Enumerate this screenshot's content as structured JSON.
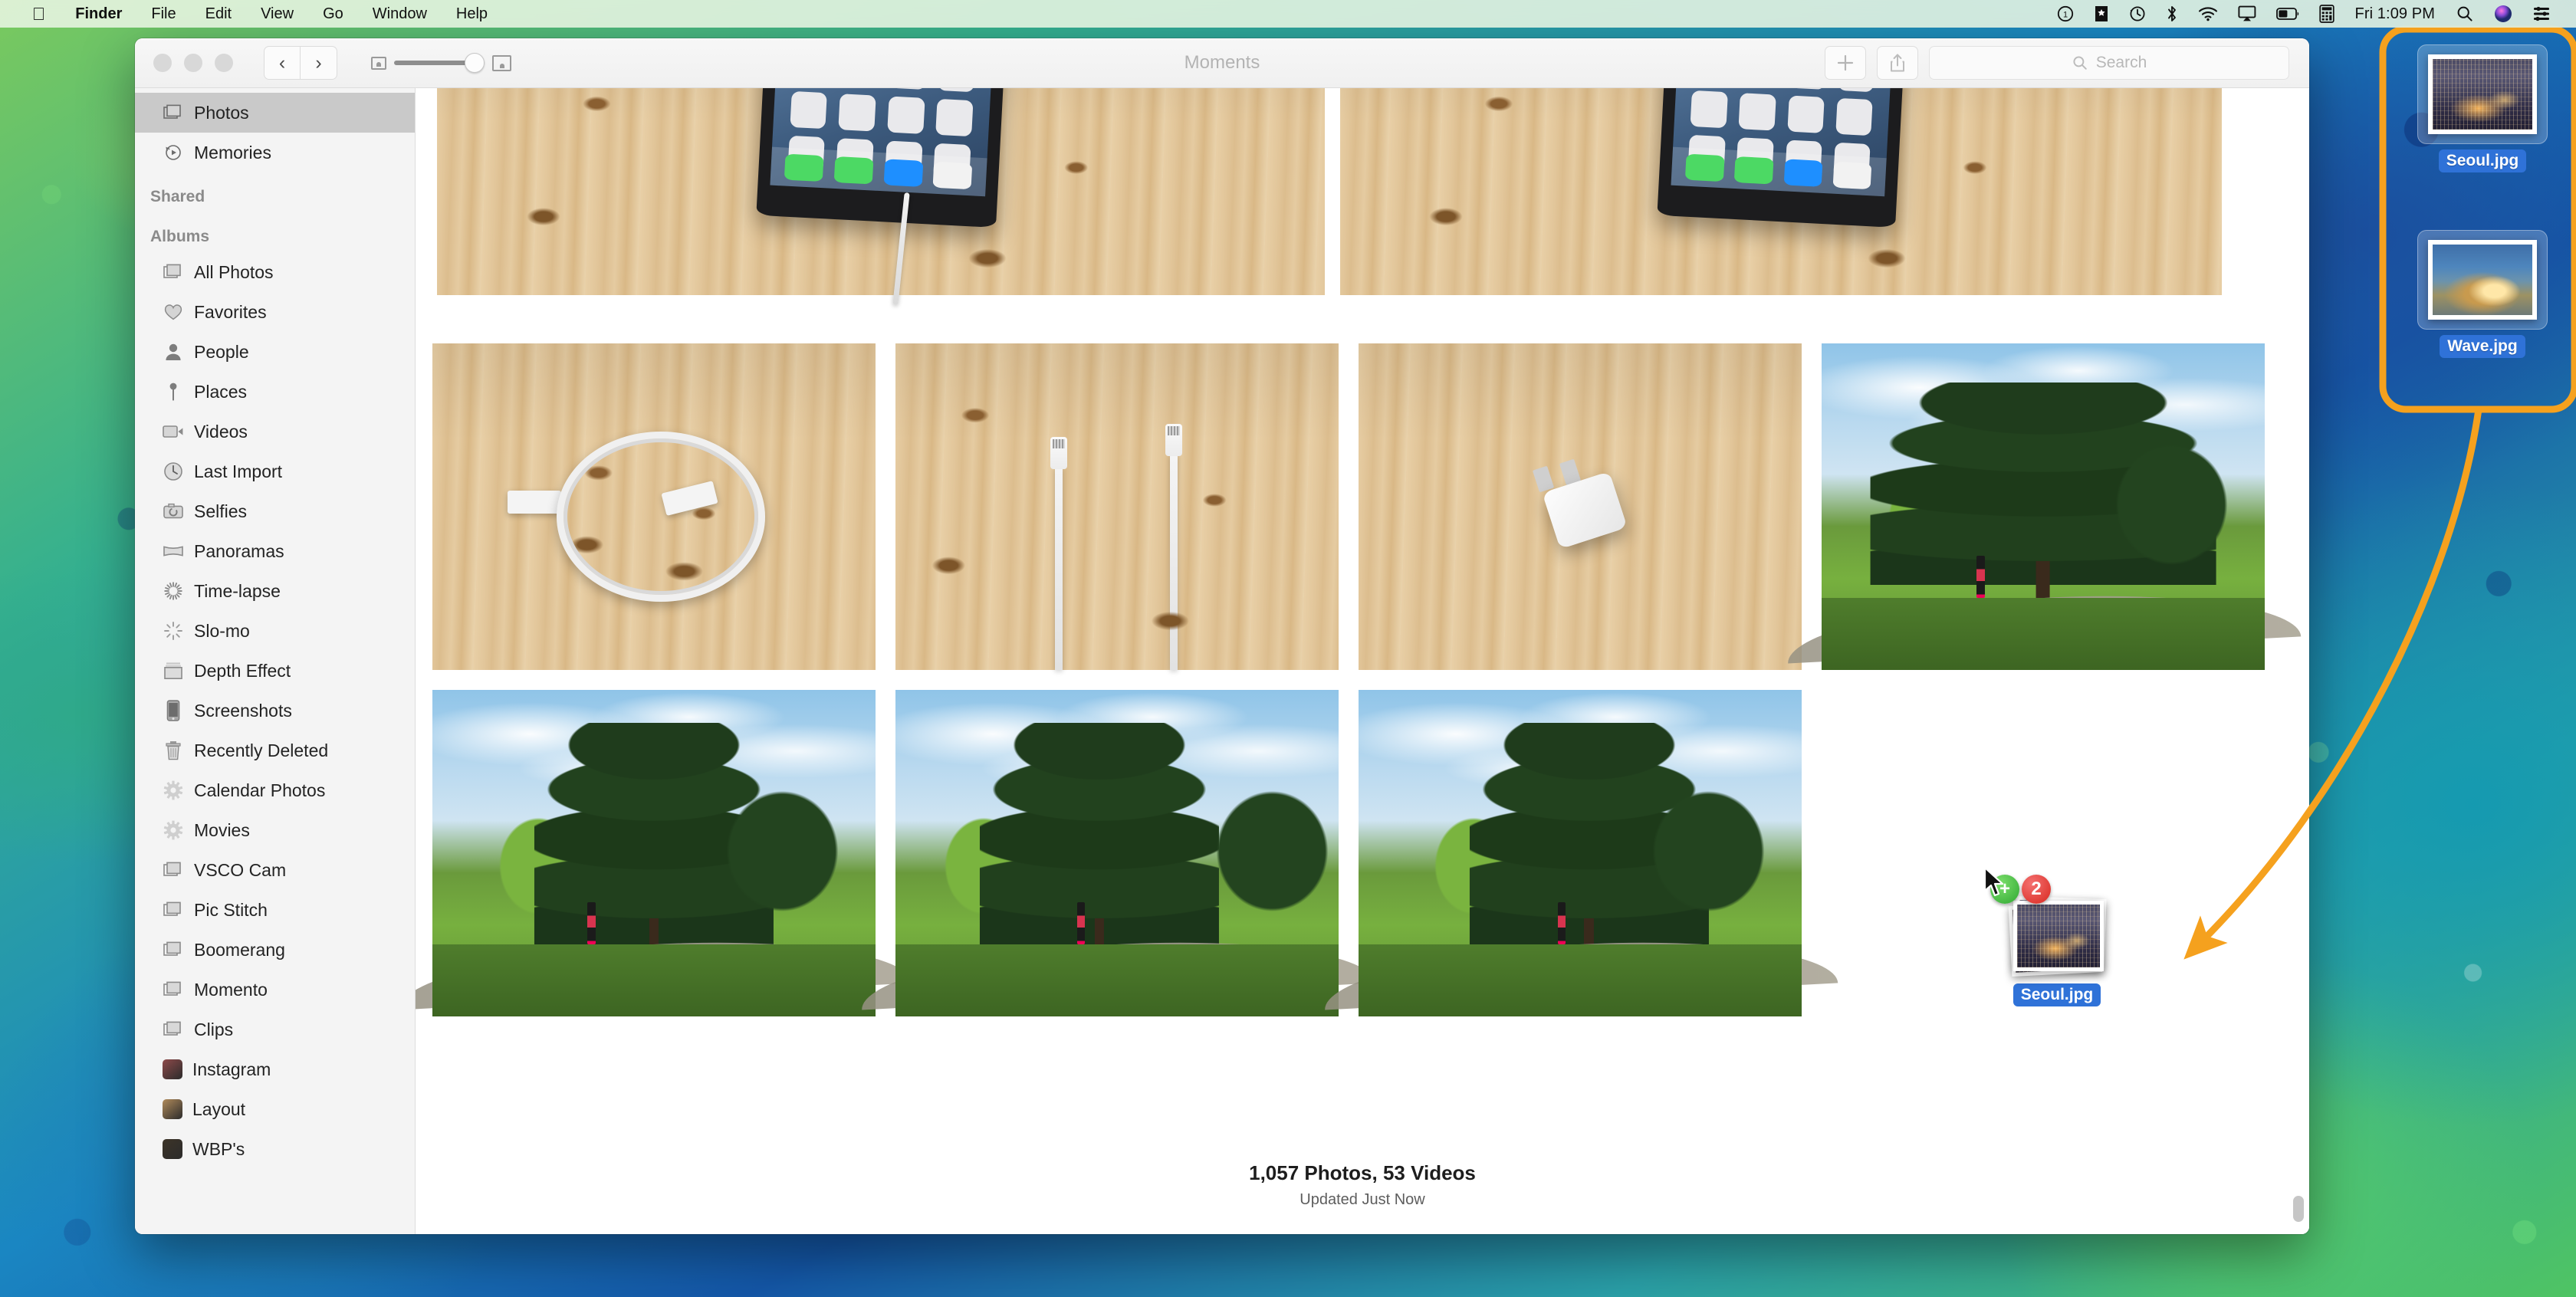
{
  "menubar": {
    "apple_logo": "",
    "app_name": "Finder",
    "menus": [
      "File",
      "Edit",
      "View",
      "Go",
      "Window",
      "Help"
    ],
    "status_icons": [
      "dnd-badge-icon",
      "bookmark-icon",
      "time-machine-icon",
      "bluetooth-icon",
      "wifi-icon",
      "airplay-icon",
      "battery-icon",
      "calculator-icon"
    ],
    "clock": "Fri 1:09 PM",
    "right_icons": [
      "spotlight-search-icon",
      "siri-icon",
      "control-center-icon"
    ]
  },
  "window": {
    "title": "Moments",
    "nav": {
      "back": "‹",
      "forward": "›"
    },
    "zoom_slider": {
      "min_label": "small-photo-icon",
      "max_label": "large-photo-icon",
      "value": 100
    },
    "toolbar": {
      "add_label": "+",
      "share_label": "share-icon"
    },
    "search": {
      "placeholder": "Search",
      "value": ""
    }
  },
  "sidebar": {
    "top_items": [
      {
        "label": "Photos",
        "icon": "photos-stack-icon",
        "selected": true
      },
      {
        "label": "Memories",
        "icon": "memories-replay-icon",
        "selected": false
      }
    ],
    "headers": {
      "shared": "Shared",
      "albums": "Albums"
    },
    "album_items": [
      {
        "label": "All Photos",
        "icon": "photos-stack-icon"
      },
      {
        "label": "Favorites",
        "icon": "heart-icon"
      },
      {
        "label": "People",
        "icon": "person-icon"
      },
      {
        "label": "Places",
        "icon": "map-pin-icon"
      },
      {
        "label": "Videos",
        "icon": "video-camera-icon"
      },
      {
        "label": "Last Import",
        "icon": "clock-icon"
      },
      {
        "label": "Selfies",
        "icon": "camera-rotate-icon"
      },
      {
        "label": "Panoramas",
        "icon": "panorama-icon"
      },
      {
        "label": "Time-lapse",
        "icon": "timelapse-icon"
      },
      {
        "label": "Slo-mo",
        "icon": "slomo-icon"
      },
      {
        "label": "Depth Effect",
        "icon": "depth-effect-icon"
      },
      {
        "label": "Screenshots",
        "icon": "iphone-icon"
      },
      {
        "label": "Recently Deleted",
        "icon": "trash-icon"
      },
      {
        "label": "Calendar Photos",
        "icon": "gear-icon"
      },
      {
        "label": "Movies",
        "icon": "gear-icon"
      },
      {
        "label": "VSCO Cam",
        "icon": "photos-stack-icon"
      },
      {
        "label": "Pic Stitch",
        "icon": "photos-stack-icon"
      },
      {
        "label": "Boomerang",
        "icon": "photos-stack-icon"
      },
      {
        "label": "Momento",
        "icon": "photos-stack-icon"
      },
      {
        "label": "Clips",
        "icon": "photos-stack-icon"
      },
      {
        "label": "Instagram",
        "icon": "album-thumbnail-icon",
        "thumb": "#8e4a4a"
      },
      {
        "label": "Layout",
        "icon": "album-thumbnail-icon",
        "thumb": "#b08a5a"
      },
      {
        "label": "WBP's",
        "icon": "album-thumbnail-icon",
        "thumb": "#3d3428"
      }
    ]
  },
  "grid": {
    "photos": [
      {
        "name": "iphone-on-wood-1",
        "kind": "wood-iphone"
      },
      {
        "name": "iphone-on-wood-2",
        "kind": "wood-iphone"
      },
      {
        "name": "coiled-cable",
        "kind": "coil"
      },
      {
        "name": "two-connectors",
        "kind": "conn"
      },
      {
        "name": "charger-brick",
        "kind": "brick"
      },
      {
        "name": "park-trees-wide",
        "kind": "park-wide"
      },
      {
        "name": "park-path-1",
        "kind": "park-tall"
      },
      {
        "name": "park-path-2",
        "kind": "park-tall"
      },
      {
        "name": "park-path-3",
        "kind": "park-tall"
      }
    ]
  },
  "footer": {
    "count": "1,057 Photos, 53 Videos",
    "updated": "Updated Just Now"
  },
  "desktop_icons": [
    {
      "label": "Seoul.jpg",
      "selected": true,
      "image": "seoul-night-cityscape"
    },
    {
      "label": "Wave.jpg",
      "selected": true,
      "image": "breaking-wave"
    }
  ],
  "drag": {
    "badge_add": "+",
    "badge_count": "2",
    "label": "Seoul.jpg",
    "image": "seoul-night-cityscape"
  },
  "annotation": {
    "color": "#F5A11E",
    "shapes": [
      "rounded-rect-highlight",
      "curved-arrow"
    ]
  },
  "colors": {
    "selection_blue": "#2f72d8",
    "annotation_orange": "#F5A11E",
    "badge_green": "#2fa832",
    "badge_red": "#d8281f",
    "sidebar_bg": "#f4f4f4",
    "sidebar_selected": "#c9c9c9"
  }
}
